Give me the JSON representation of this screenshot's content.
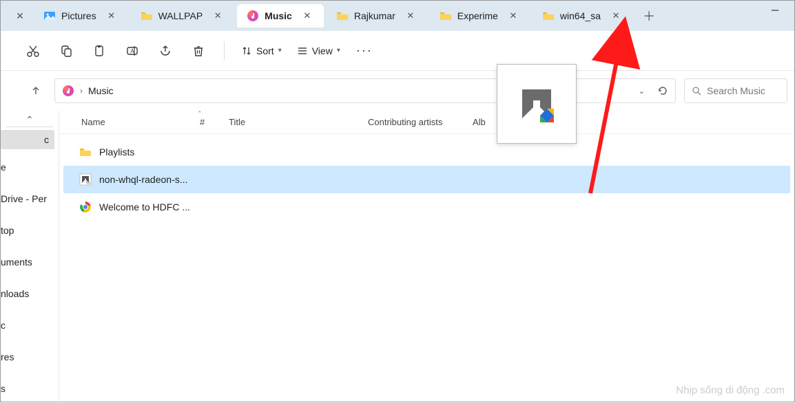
{
  "tabs": [
    {
      "label": "Pictures",
      "icon": "pictures"
    },
    {
      "label": "WALLPAP",
      "icon": "folder"
    },
    {
      "label": "Music",
      "icon": "music",
      "active": true
    },
    {
      "label": "Rajkumar",
      "icon": "folder"
    },
    {
      "label": "Experime",
      "icon": "folder"
    },
    {
      "label": "win64_sa",
      "icon": "folder"
    }
  ],
  "toolbar": {
    "sort_label": "Sort",
    "view_label": "View"
  },
  "breadcrumb": {
    "location": "Music"
  },
  "search": {
    "placeholder": "Search Music"
  },
  "columns": {
    "name": "Name",
    "number": "#",
    "title": "Title",
    "contributing": "Contributing artists",
    "album": "Alb"
  },
  "sidebar": {
    "active": "c",
    "items": [
      "e",
      "Drive - Per",
      "top",
      "uments",
      "nloads",
      "c",
      "res",
      "s"
    ]
  },
  "files": [
    {
      "name": "Playlists",
      "icon": "folder"
    },
    {
      "name": "non-whql-radeon-s...",
      "icon": "amd",
      "selected": true
    },
    {
      "name": "Welcome to HDFC ...",
      "icon": "chrome"
    }
  ],
  "watermark": "Nhịp sống di động .com"
}
